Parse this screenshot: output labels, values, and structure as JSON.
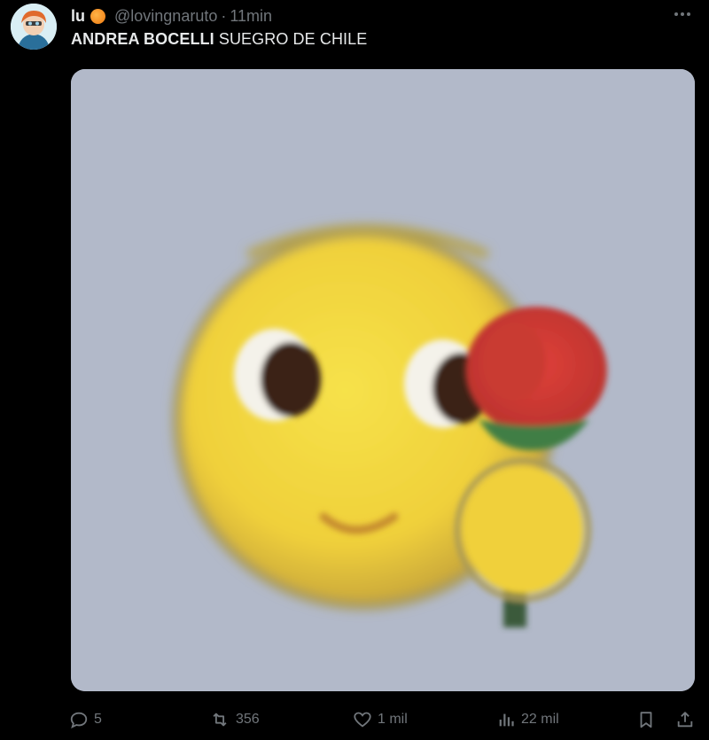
{
  "tweet": {
    "display_name": "lu",
    "handle": "@lovingnaruto",
    "separator": "·",
    "time": "11min",
    "text_bold": "ANDREA BOCELLI",
    "text_rest": " SUEGRO DE CHILE"
  },
  "actions": {
    "replies": "5",
    "retweets": "356",
    "likes": "1 mil",
    "views": "22 mil"
  },
  "icons": {
    "badge": "orange-emoji-icon",
    "more": "more-dots-icon",
    "reply": "reply-icon",
    "retweet": "retweet-icon",
    "like": "heart-icon",
    "views": "views-chart-icon",
    "bookmark": "bookmark-icon",
    "share": "share-icon"
  },
  "colors": {
    "background": "#000000",
    "text": "#e7e9ea",
    "muted": "#71767b",
    "media_background": "#b2b9c9",
    "emoji_face": "#f4d23a"
  }
}
